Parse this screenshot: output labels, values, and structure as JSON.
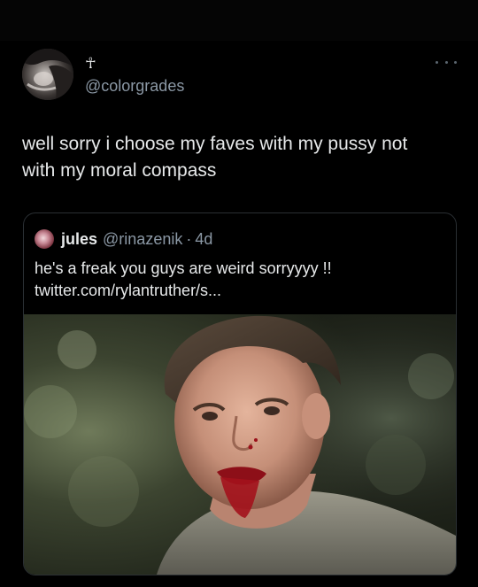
{
  "tweet": {
    "display_name": "☥",
    "handle": "@colorgrades",
    "text_line1": "well sorry i choose my faves with my pussy not",
    "text_line2": "with my moral compass",
    "avatar_icon": "profile-avatar",
    "more_icon": "more-options-icon"
  },
  "quote": {
    "name": "jules",
    "handle": "@rinazenik",
    "separator": "·",
    "time": "4d",
    "text_line1": "he's a freak you guys are weird sorryyyy !!",
    "text_line2": "twitter.com/rylantruther/s...",
    "media_description_icon": "quoted-photo"
  },
  "colors": {
    "background": "#000000",
    "text_primary": "#e7e9ea",
    "text_secondary": "#8b98a5",
    "card_border": "#2a2f33"
  }
}
